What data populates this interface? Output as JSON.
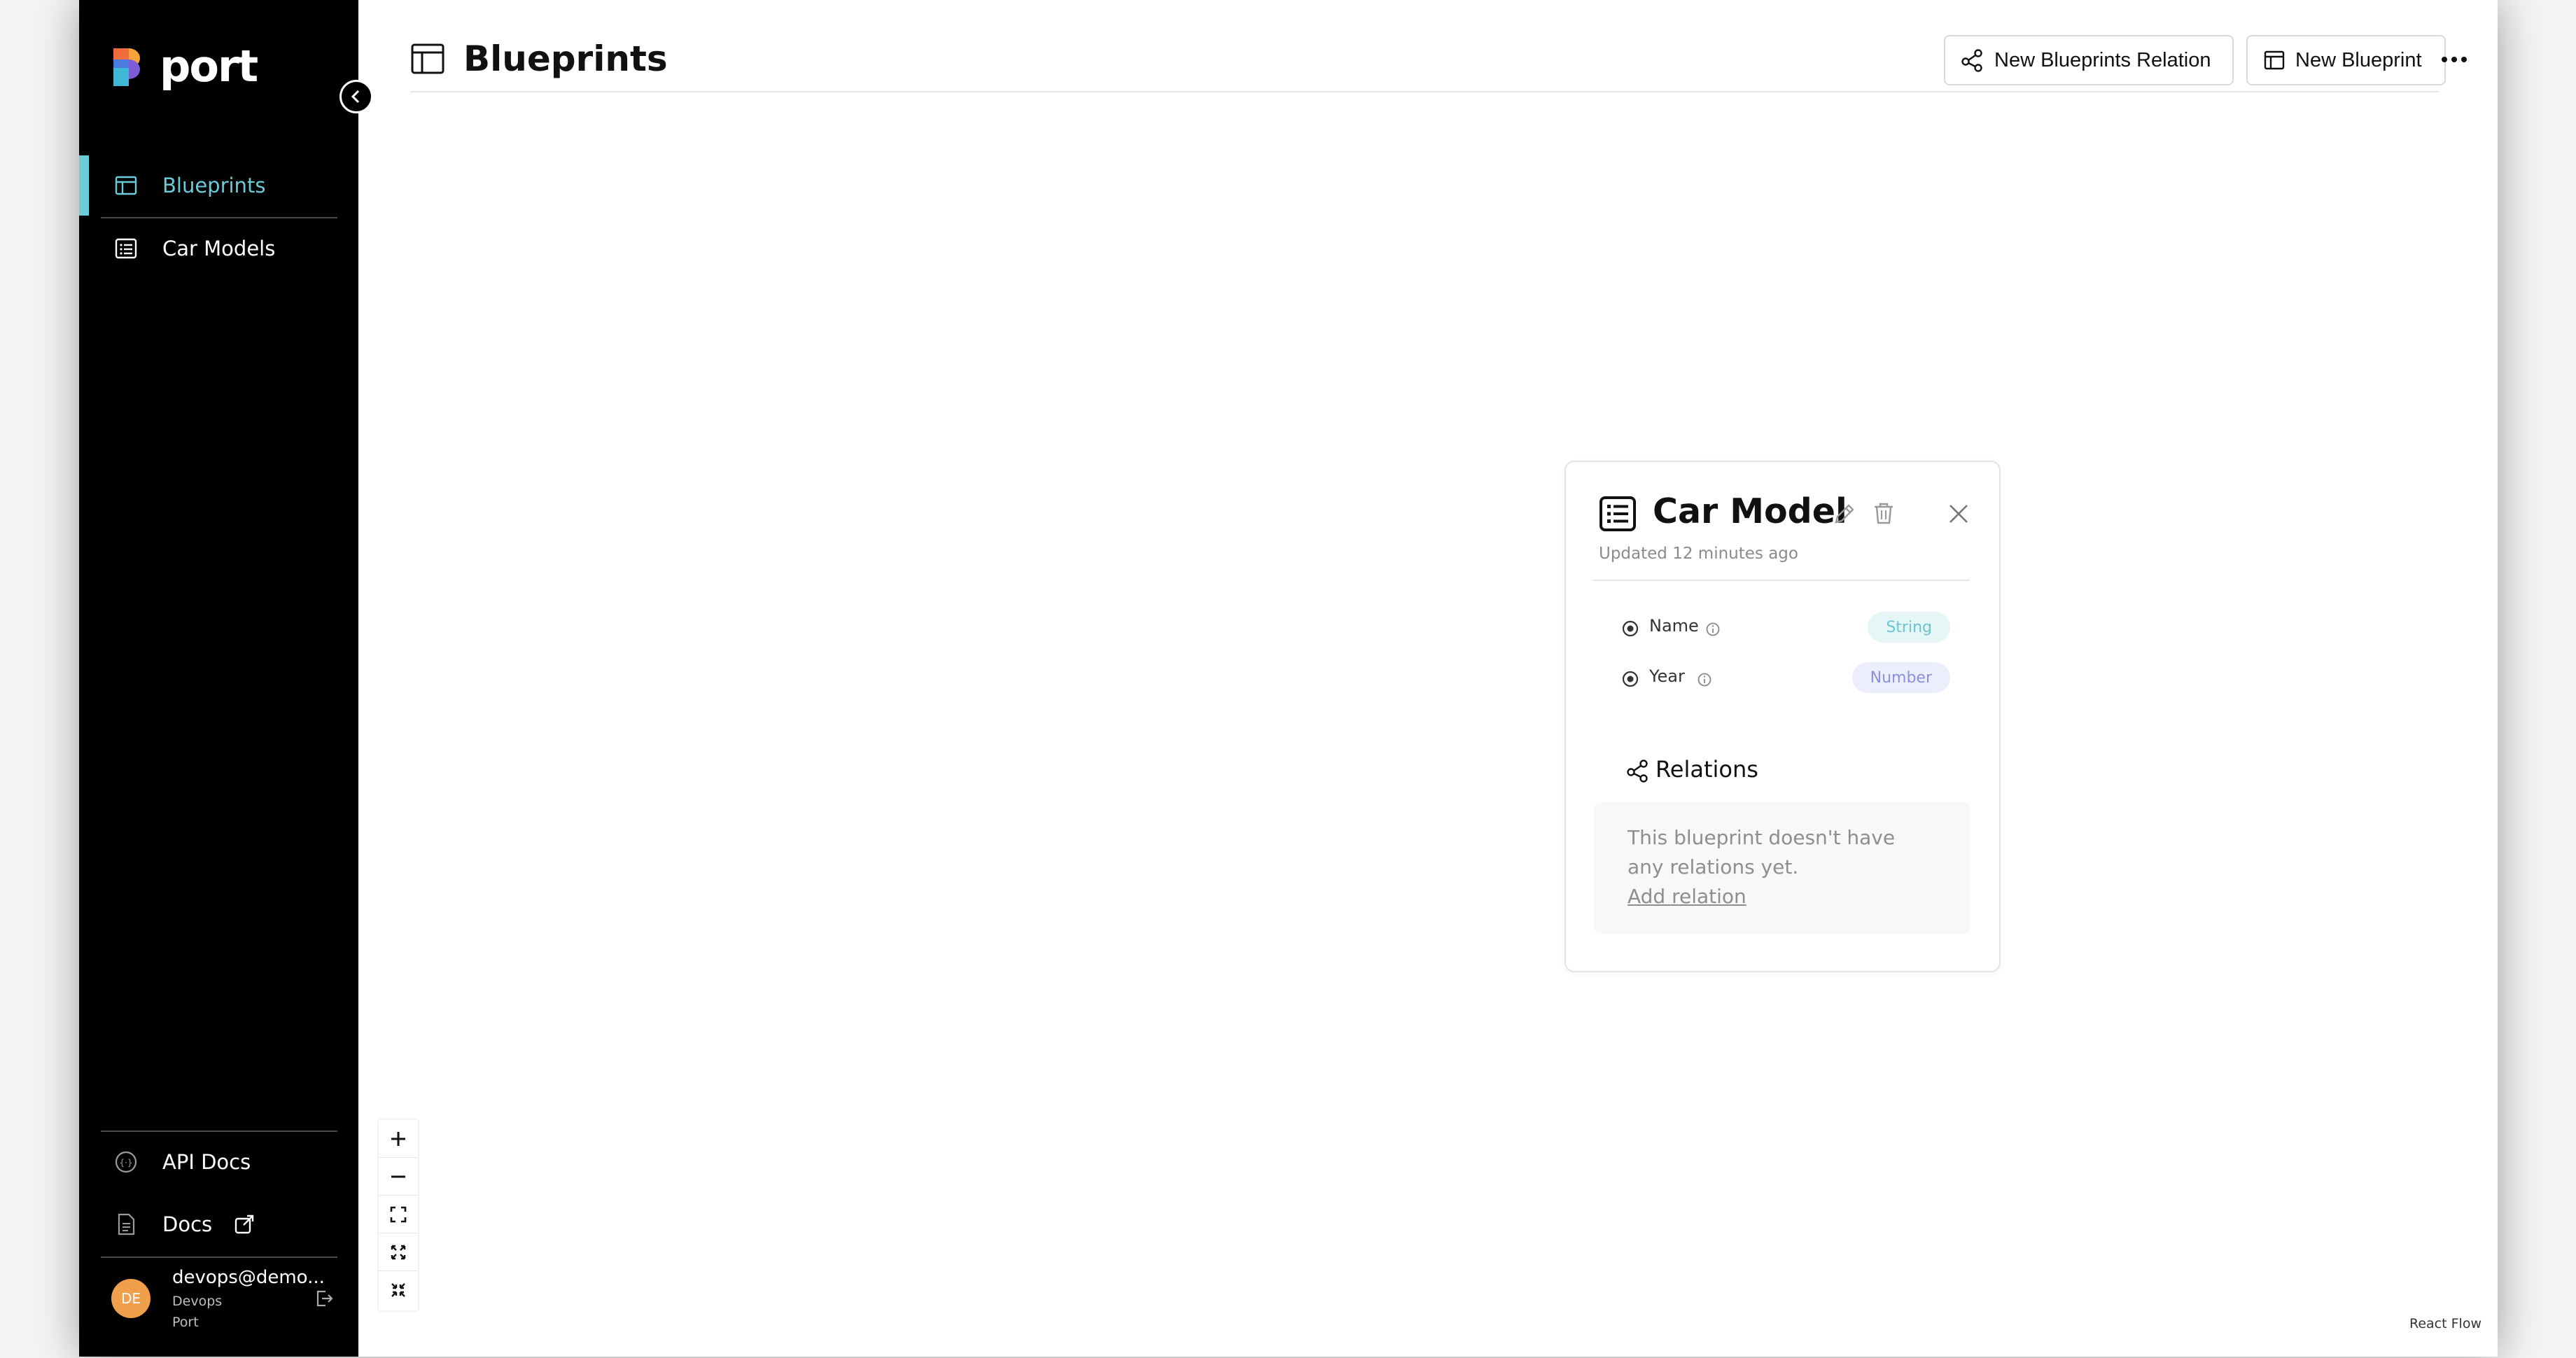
{
  "brand": {
    "logo_text": "port",
    "colors": {
      "accent": "#6ccbd8",
      "sidebar_bg": "#000000",
      "avatar": "#f0a04c"
    }
  },
  "sidebar": {
    "items": [
      {
        "label": "Blueprints",
        "icon": "blueprint-icon",
        "active": true
      },
      {
        "label": "Car Models",
        "icon": "list-icon",
        "active": false
      }
    ],
    "bottom_items": [
      {
        "label": "API Docs",
        "icon": "api-icon"
      },
      {
        "label": "Docs",
        "icon": "document-icon"
      }
    ],
    "user": {
      "initials": "DE",
      "email": "devops@demo...",
      "org": "Devops",
      "company": "Port"
    }
  },
  "header": {
    "title": "Blueprints",
    "new_relation_label": "New Blueprints Relation",
    "new_blueprint_label": "New Blueprint"
  },
  "card": {
    "title": "Car Model",
    "updated": "Updated 12 minutes ago",
    "properties": [
      {
        "name": "Name",
        "type": "String"
      },
      {
        "name": "Year",
        "type": "Number"
      }
    ],
    "relations_title": "Relations",
    "relations_empty": "This blueprint doesn't have any relations yet.",
    "add_relation": "Add relation"
  },
  "canvas": {
    "attribution": "React Flow"
  }
}
